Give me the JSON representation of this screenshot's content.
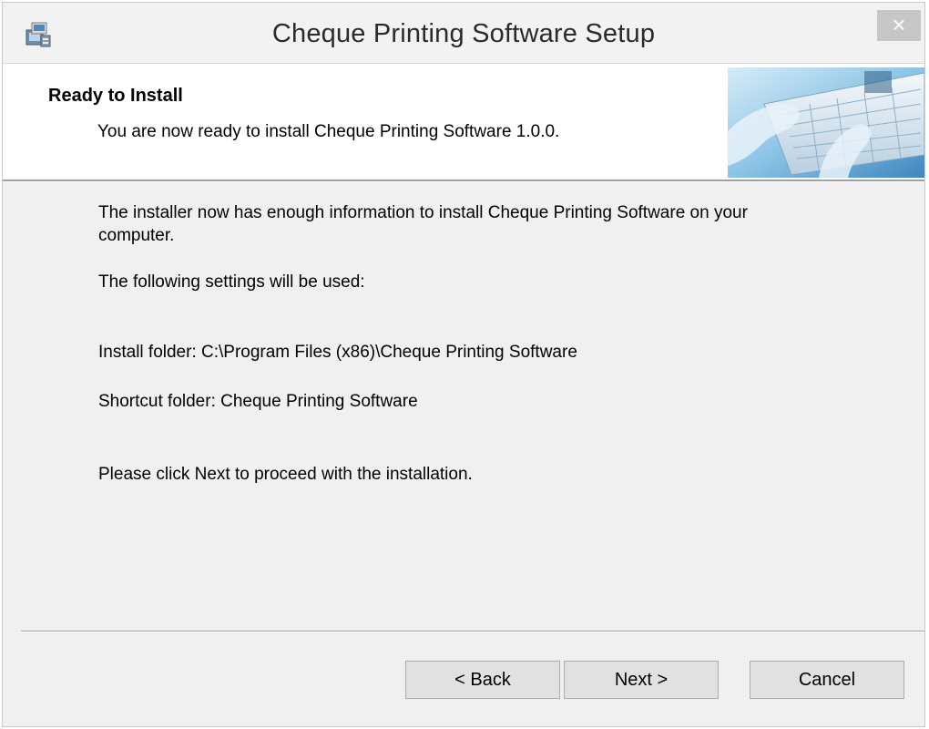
{
  "window": {
    "title": "Cheque Printing Software Setup",
    "close_label": "×"
  },
  "header": {
    "title": "Ready to Install",
    "subtitle": "You are now ready to install Cheque Printing Software 1.0.0."
  },
  "body": {
    "intro_line1": "The installer now has enough information to install Cheque Printing Software on your",
    "intro_line2": "computer.",
    "settings_intro": "The following settings will be used:",
    "install_folder": "Install folder: C:\\Program Files (x86)\\Cheque Printing Software",
    "shortcut_folder": "Shortcut folder: Cheque Printing Software",
    "proceed": "Please click Next to proceed with the installation."
  },
  "buttons": {
    "back": "< Back",
    "next": "Next >",
    "cancel": "Cancel"
  },
  "icons": {
    "app": "installer-package-icon",
    "banner": "keyboard-hands-image"
  },
  "colors": {
    "window_bg": "#f0f0f0",
    "header_bg": "#ffffff",
    "close_bg": "#c7c7c7",
    "button_bg": "#e1e1e1"
  }
}
